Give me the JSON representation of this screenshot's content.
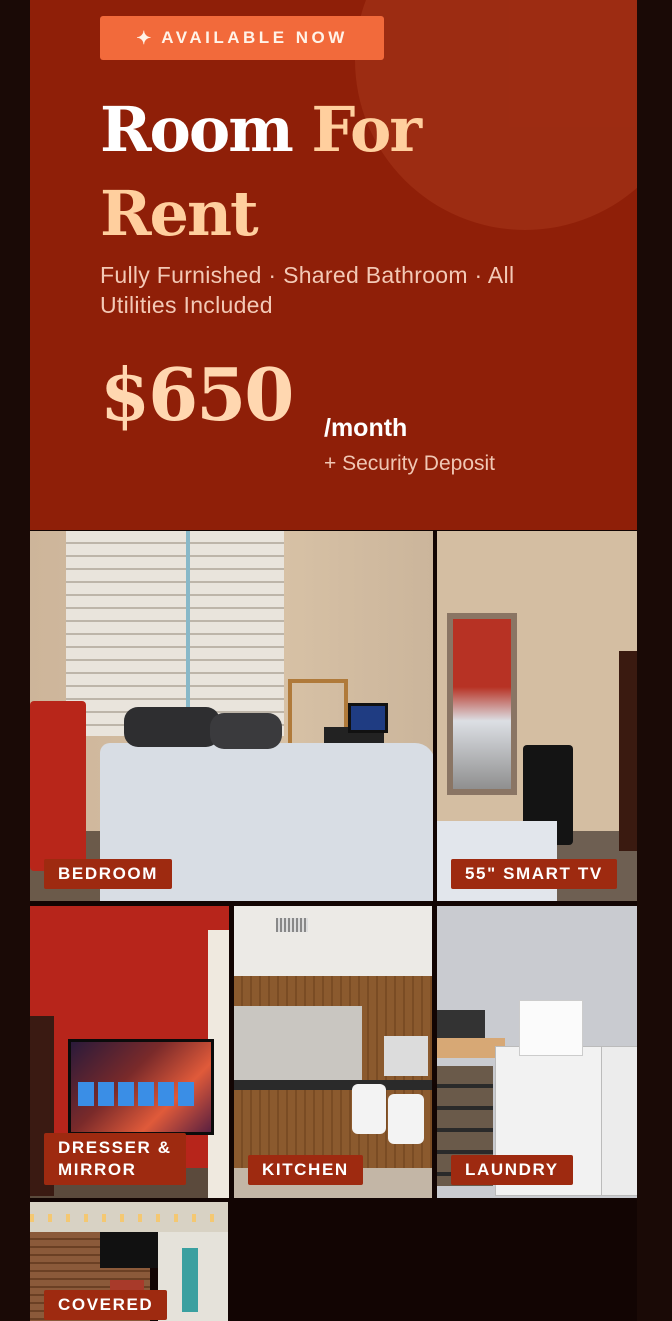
{
  "hero": {
    "badge_icon": "sparkle-icon",
    "badge_label": "AVAILABLE NOW",
    "title_part1": "Room ",
    "title_part2": "For",
    "title_part3": "Rent",
    "subtitle": "Fully Furnished · Shared Bathroom · All Utilities Included",
    "price": "$650",
    "per": "/month",
    "deposit": "+ Security Deposit"
  },
  "photos": [
    {
      "label": "BEDROOM"
    },
    {
      "label": "55\" SMART TV"
    },
    {
      "label": "DRESSER &\nMIRROR"
    },
    {
      "label": "KITCHEN"
    },
    {
      "label": "LAUNDRY"
    },
    {
      "label": "COVERED"
    }
  ],
  "colors": {
    "hero_bg": "#8f1f08",
    "badge_bg": "#f26a3b",
    "accent_text": "#ffcf9e",
    "label_bg": "#9e2a10",
    "page_bg": "#120503"
  }
}
